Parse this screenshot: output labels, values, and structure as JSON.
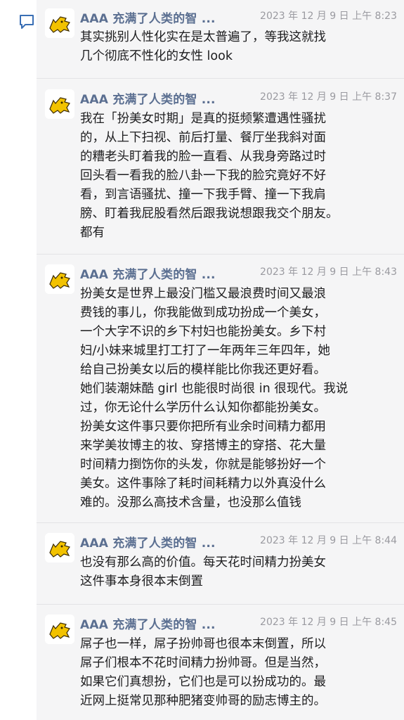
{
  "messages": [
    {
      "author": "AAA 充满了人类的智 ...",
      "time": "2023 年 12 月 9 日 上午 8:23",
      "text": "其实挑别人性化实在是太普遍了，等我这就找\n几个彻底不性化的女性 look"
    },
    {
      "author": "AAA 充满了人类的智 ...",
      "time": "2023 年 12 月 9 日 上午 8:37",
      "text": "我在「扮美女时期」是真的挺频繁遭遇性骚扰\n的，从上下扫视、前后打量、餐厅坐我斜对面\n的糟老头盯着我的脸一直看、从我身旁路过时\n回头看一看我的脸八卦一下我的脸究竟好不好\n看，到言语骚扰、撞一下我手臂、撞一下我肩\n膀、盯着我屁股看然后跟我说想跟我交个朋友。\n都有"
    },
    {
      "author": "AAA 充满了人类的智 ...",
      "time": "2023 年 12 月 9 日 上午 8:43",
      "text": "扮美女是世界上最没门槛又最浪费时间又最浪\n费钱的事儿，你我能做到成功扮成一个美女，\n一个大字不识的乡下村妇也能扮美女。乡下村\n妇/小妹来城里打工打了一年两年三年四年，她\n给自己扮美女以后的模样能比你我还更好看。\n她们装潮妹酷 girl 也能很时尚很 in 很现代。我说\n过，你无论什么学历什么认知你都能扮美女。\n扮美女这件事只要你把所有业余时间精力都用\n来学美妆博主的妆、穿搭博主的穿搭、花大量\n时间精力捯饬你的头发，你就是能够扮好一个\n美女。这件事除了耗时间耗精力以外真没什么\n难的。没那么高技术含量，也没那么值钱"
    },
    {
      "author": "AAA 充满了人类的智 ...",
      "time": "2023 年 12 月 9 日 上午 8:44",
      "text": "也没有那么高的价值。每天花时间精力扮美女\n这件事本身很本末倒置"
    },
    {
      "author": "AAA 充满了人类的智 ...",
      "time": "2023 年 12 月 9 日 上午 8:45",
      "text": "屌子也一样，屌子扮帅哥也很本末倒置，所以\n屌子们根本不花时间精力扮帅哥。但是当然，\n如果它们真想扮，它们也是可以扮成功的。最\n近网上挺常见那种肥猪变帅哥的励志博主的。"
    }
  ],
  "icons": {
    "sidebar": "comment-icon",
    "avatar": "yellow-cat-avatar-icon"
  },
  "colors": {
    "name": "#5b6f91",
    "time": "#9a9aa0",
    "text": "#1d1d1f",
    "feed_bg": "#f5f5f6",
    "icon": "#3a6fb5",
    "avatar_cat": "#f2c200"
  }
}
